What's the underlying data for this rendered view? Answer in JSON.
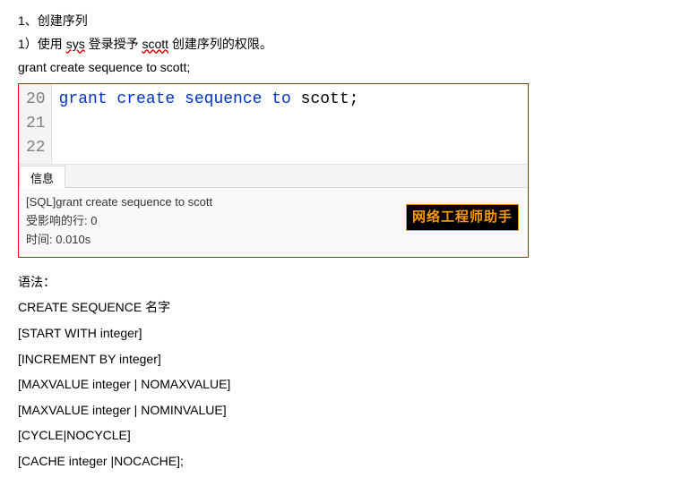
{
  "doc": {
    "line1": "1、创建序列",
    "line2_prefix": "1）使用 ",
    "line2_sys": "sys",
    "line2_mid": " 登录授予 ",
    "line2_scott": "scott",
    "line2_suffix": " 创建序列的权限。",
    "line3": "grant create sequence to scott;"
  },
  "editor": {
    "lines": [
      "20",
      "21",
      "22"
    ],
    "code_kw": "grant create sequence to ",
    "code_ident": "scott;"
  },
  "tabs": {
    "info": "信息"
  },
  "output": {
    "sql": "[SQL]grant create sequence to scott",
    "affected_label": "受影响的行: ",
    "affected_value": "0",
    "time_label": "时间: ",
    "time_value": "0.010s"
  },
  "watermark": "网络工程师助手",
  "syntax": {
    "header": "语法：",
    "l1": "CREATE SEQUENCE  名字",
    "l2": "[START WITH integer]",
    "l3": "[INCREMENT BY integer]",
    "l4": "[MAXVALUE integer | NOMAXVALUE]",
    "l5": "[MAXVALUE integer | NOMINVALUE]",
    "l6": "[CYCLE|NOCYCLE]",
    "l7": "[CACHE integer |NOCACHE];"
  }
}
